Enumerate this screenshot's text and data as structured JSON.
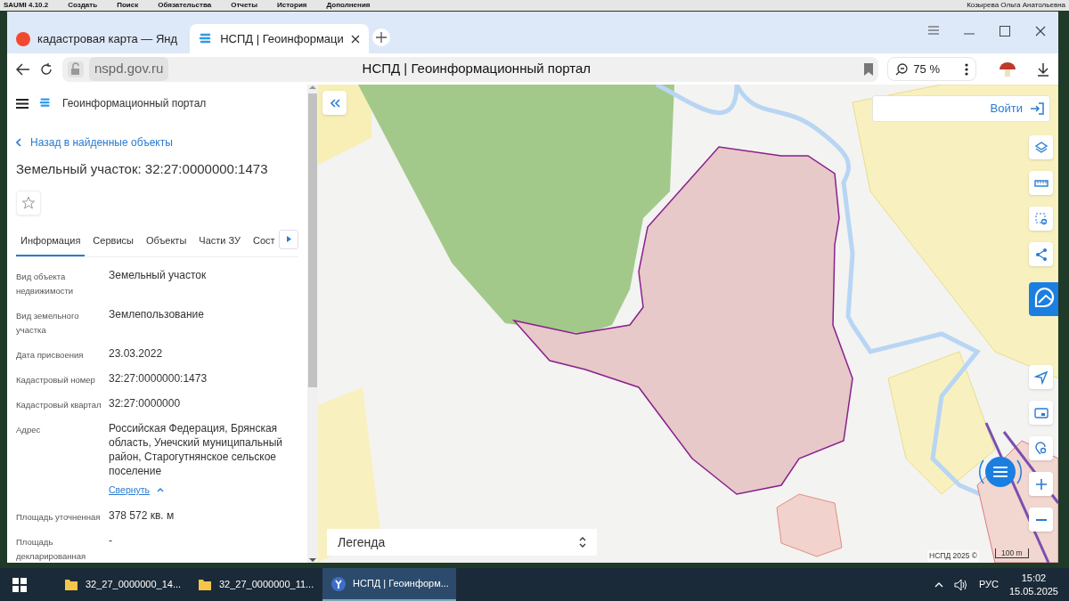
{
  "app_menu": {
    "title": "SAUMI 4.10.2",
    "items": [
      "Создать",
      "Поиск",
      "Обязательства",
      "Отчеты",
      "История",
      "Дополнения"
    ],
    "user": "Козырева Ольга Анатольевна"
  },
  "browser": {
    "tabs": [
      {
        "title": "кадастровая карта — Янд",
        "selected": false
      },
      {
        "title": "НСПД | Геоинформаци",
        "selected": true
      }
    ],
    "address": "nspd.gov.ru",
    "page_title": "НСПД | Геоинформационный портал",
    "zoom": "75 %"
  },
  "sidebar": {
    "app_title": "Геоинформационный портал",
    "back_link": "Назад в найденные объекты",
    "heading": "Земельный участок: 32:27:0000000:1473",
    "favorite": false,
    "tabs": [
      {
        "label": "Информация",
        "selected": true
      },
      {
        "label": "Сервисы",
        "selected": false
      },
      {
        "label": "Объекты",
        "selected": false
      },
      {
        "label": "Части ЗУ",
        "selected": false
      },
      {
        "label": "Сост",
        "selected": false
      }
    ],
    "fields": [
      {
        "label": "Вид объекта недвижимости",
        "value": "Земельный участок"
      },
      {
        "label": "Вид земельного участка",
        "value": "Землепользование"
      },
      {
        "label": "Дата присвоения",
        "value": "23.03.2022"
      },
      {
        "label": "Кадастровый номер",
        "value": "32:27:0000000:1473"
      },
      {
        "label": "Кадастровый квартал",
        "value": "32:27:0000000"
      },
      {
        "label": "Адрес",
        "value": "Российская Федерация, Брянская область, Унечский муниципальный район, Старогутнянское сельское поселение",
        "link": "Свернуть"
      },
      {
        "label": "Площадь уточненная",
        "value": "378 572 кв. м"
      },
      {
        "label": "Площадь декларированная",
        "value": "-"
      }
    ]
  },
  "map": {
    "login": "Войти",
    "legend": "Легенда",
    "attribution": "НСПД 2025 ©",
    "scale": "100 m"
  },
  "taskbar": {
    "items": [
      {
        "title": "32_27_0000000_14...",
        "kind": "folder",
        "selected": false
      },
      {
        "title": "32_27_0000000_11...",
        "kind": "folder",
        "selected": false
      },
      {
        "title": "НСПД | Геоинформ...",
        "kind": "browser",
        "selected": true
      }
    ],
    "language": "РУС",
    "time": "15:02",
    "date": "15.05.2025"
  }
}
